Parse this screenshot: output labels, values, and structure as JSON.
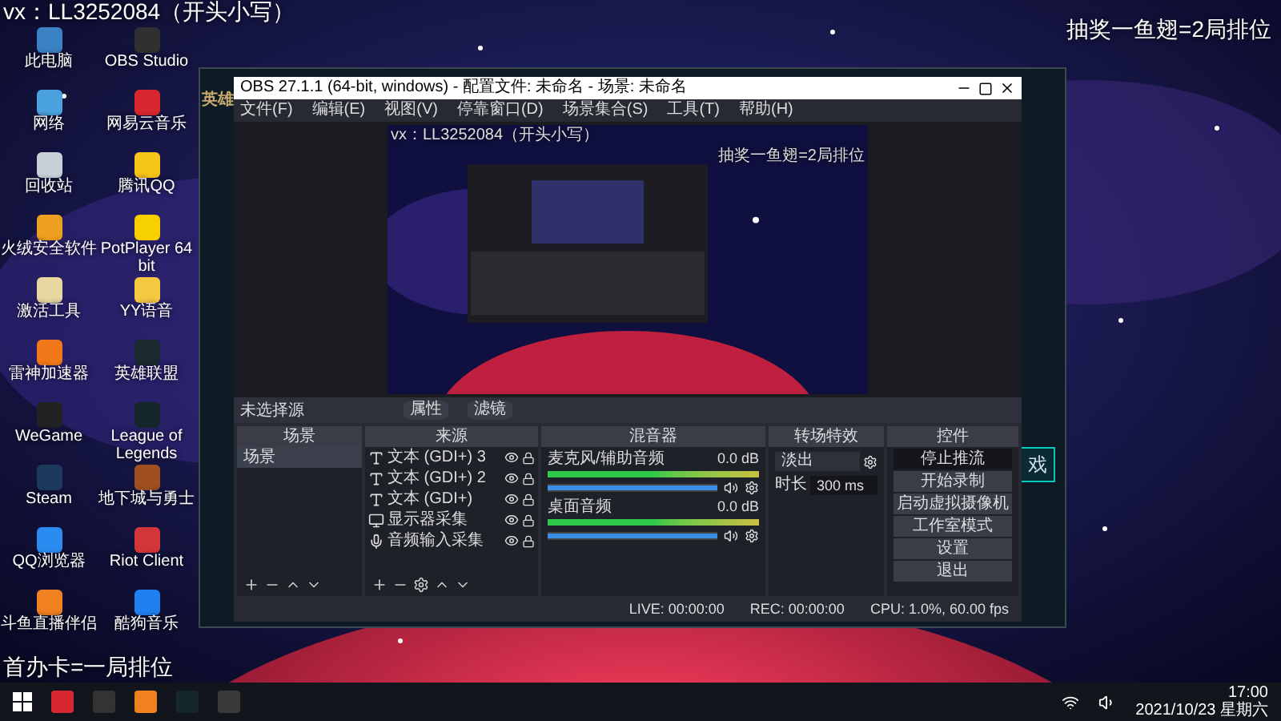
{
  "overlays": {
    "top_left": "vx：LL3252084（开头小写）",
    "top_right": "抽奖一鱼翅=2局排位",
    "bottom_left": "首办卡=一局排位"
  },
  "desktop_icons": [
    {
      "label": "此电脑",
      "color": "#3b82c4"
    },
    {
      "label": "OBS Studio",
      "color": "#303030"
    },
    {
      "label": "网络",
      "color": "#4aa3df"
    },
    {
      "label": "网易云音乐",
      "color": "#d7282f"
    },
    {
      "label": "回收站",
      "color": "#c8d0d8"
    },
    {
      "label": "腾讯QQ",
      "color": "#f5c518"
    },
    {
      "label": "火绒安全软件",
      "color": "#f0a020"
    },
    {
      "label": "PotPlayer 64 bit",
      "color": "#f6d000"
    },
    {
      "label": "激活工具",
      "color": "#e8d8a0"
    },
    {
      "label": "YY语音",
      "color": "#f5c842"
    },
    {
      "label": "雷神加速器",
      "color": "#f07818"
    },
    {
      "label": "英雄联盟",
      "color": "#1a2a30"
    },
    {
      "label": "WeGame",
      "color": "#222222"
    },
    {
      "label": "League of Legends",
      "color": "#15262c"
    },
    {
      "label": "Steam",
      "color": "#1b3a5c"
    },
    {
      "label": "地下城与勇士",
      "color": "#a05020"
    },
    {
      "label": "QQ浏览器",
      "color": "#2a8cf0"
    },
    {
      "label": "Riot Client",
      "color": "#d13639"
    },
    {
      "label": "斗鱼直播伴侣",
      "color": "#f08020"
    },
    {
      "label": "酷狗音乐",
      "color": "#2080f0"
    }
  ],
  "game_window": {
    "logo": "英雄",
    "button_text": "戏"
  },
  "obs": {
    "title": "OBS 27.1.1 (64-bit, windows) - 配置文件: 未命名 - 场景: 未命名",
    "menu": [
      "文件(F)",
      "编辑(E)",
      "视图(V)",
      "停靠窗口(D)",
      "场景集合(S)",
      "工具(T)",
      "帮助(H)"
    ],
    "preview": {
      "top_left": "vx：LL3252084（开头小写）",
      "top_right": "抽奖一鱼翅=2局排位"
    },
    "selection_label": "未选择源",
    "source_buttons": [
      "属性",
      "滤镜"
    ],
    "scenes": {
      "title": "场景",
      "items": [
        {
          "label": "场景",
          "selected": true
        }
      ]
    },
    "sources": {
      "title": "来源",
      "items": [
        {
          "label": "文本 (GDI+) 3",
          "kind": "text",
          "visible": true
        },
        {
          "label": "文本 (GDI+) 2",
          "kind": "text",
          "visible": true
        },
        {
          "label": "文本 (GDI+)",
          "kind": "text",
          "visible": true
        },
        {
          "label": "显示器采集",
          "kind": "display",
          "visible": true
        },
        {
          "label": "音频输入采集",
          "kind": "audio",
          "visible": true
        }
      ]
    },
    "mixer": {
      "title": "混音器",
      "channels": [
        {
          "name": "麦克风/辅助音频",
          "reading": "0.0 dB",
          "level": 1
        },
        {
          "name": "桌面音频",
          "reading": "0.0 dB",
          "level": 1
        }
      ]
    },
    "transitions": {
      "title": "转场特效",
      "type": "淡出",
      "duration_label": "时长",
      "duration": "300 ms"
    },
    "controls": {
      "title": "控件",
      "buttons": [
        {
          "label": "停止推流",
          "active": true
        },
        {
          "label": "开始录制",
          "active": false
        },
        {
          "label": "启动虚拟摄像机",
          "active": false
        },
        {
          "label": "工作室模式",
          "active": false
        },
        {
          "label": "设置",
          "active": false
        },
        {
          "label": "退出",
          "active": false
        }
      ]
    },
    "status": {
      "live": "LIVE: 00:00:00",
      "rec": "REC: 00:00:00",
      "cpu": "CPU: 1.0%, 60.00 fps"
    }
  },
  "taskbar": {
    "apps": [
      {
        "color": "#d7282f"
      },
      {
        "color": "#333333"
      },
      {
        "color": "#f08020"
      },
      {
        "color": "#15262c"
      },
      {
        "color": "#3a3a3a"
      }
    ],
    "time": "17:00",
    "date": "2021/10/23 星期六"
  }
}
